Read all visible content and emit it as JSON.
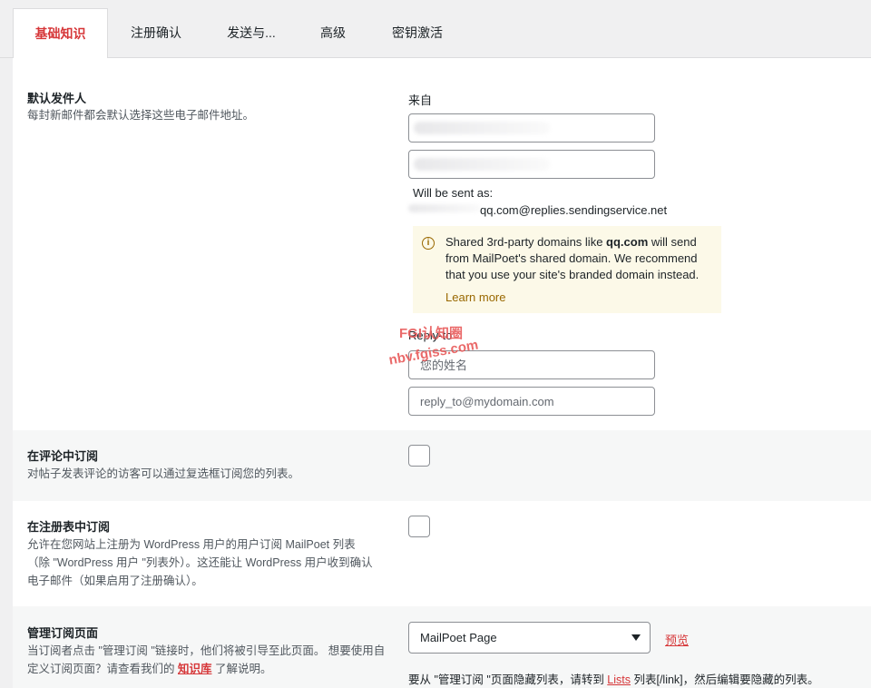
{
  "tabs": [
    {
      "label": "基础知识",
      "active": true
    },
    {
      "label": "注册确认",
      "active": false
    },
    {
      "label": "发送与...",
      "active": false
    },
    {
      "label": "高级",
      "active": false
    },
    {
      "label": "密钥激活",
      "active": false
    }
  ],
  "default_sender": {
    "title": "默认发件人",
    "description": "每封新邮件都会默认选择这些电子邮件地址。",
    "from_label": "来自",
    "will_be_sent_as": "Will be sent as:",
    "sent_address": "qq.com@replies.sendingservice.net",
    "notice": {
      "text_before": "Shared 3rd-party domains like ",
      "domain": "qq.com",
      "text_after": " will send from MailPoet's shared domain. We recommend that you use your site's branded domain instead.",
      "learn_more": "Learn more"
    },
    "reply_to_label": "Reply-to",
    "reply_name_placeholder": "您的姓名",
    "reply_email_placeholder": "reply_to@mydomain.com"
  },
  "subscribe_comments": {
    "title": "在评论中订阅",
    "description": "对帖子发表评论的访客可以通过复选框订阅您的列表。"
  },
  "subscribe_registration": {
    "title": "在注册表中订阅",
    "description": "允许在您网站上注册为 WordPress 用户的用户订阅 MailPoet 列表（除 \"WordPress 用户 \"列表外）。这还能让 WordPress 用户收到确认电子邮件（如果启用了注册确认）。"
  },
  "manage_subscription": {
    "title": "管理订阅页面",
    "description_before": "当订阅者点击 \"管理订阅 \"链接时，他们将被引导至此页面。 想要使用自定义订阅页面？请查看我们的 ",
    "kb_link": "知识库",
    "description_after": " 了解说明。",
    "select_value": "MailPoet Page",
    "preview": "预览",
    "hint_before": "要从 \"管理订阅 \"页面隐藏列表，请转到 ",
    "hint_link": "Lists",
    "hint_after": " 列表[/link]，然后编辑要隐藏的列表。"
  },
  "watermark": {
    "line1": "FGI认知圈",
    "line2": "nbv.fgiss.com"
  },
  "colors": {
    "accent": "#d63638",
    "notice_bg": "#fcf9e8",
    "notice_accent": "#996800"
  }
}
